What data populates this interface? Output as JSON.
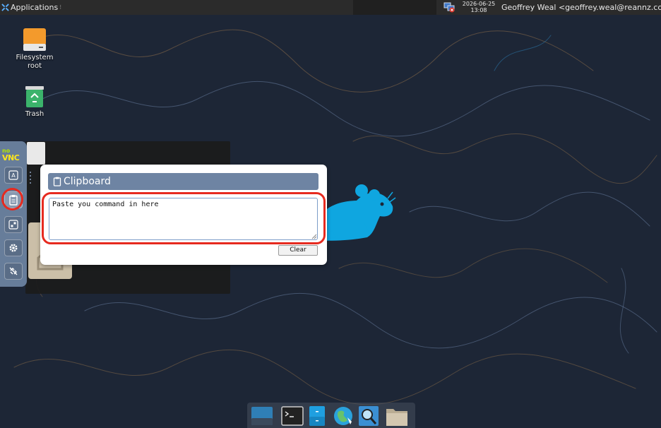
{
  "top_panel": {
    "applications_label": "Applications",
    "date": "2026-06-25",
    "time": "13:08",
    "user": "Geoffrey Weal <geoffrey.weal@reannz.co.nz>"
  },
  "desktop_icons": [
    {
      "name": "filesystem-root",
      "label_line1": "Filesystem",
      "label_line2": "root"
    },
    {
      "name": "trash",
      "label_line1": "Trash"
    }
  ],
  "novnc": {
    "logo_no": "no",
    "logo_vnc": "VNC",
    "buttons": [
      "keyboard",
      "clipboard",
      "fullscreen",
      "settings",
      "disconnect"
    ]
  },
  "clipboard": {
    "title": "Clipboard",
    "text": "Paste you command in here",
    "clear_label": "Clear"
  },
  "dock_items": [
    "show-desktop",
    "terminal",
    "file-manager",
    "web-browser",
    "app-finder",
    "home-folder"
  ],
  "colors": {
    "panel_bg": "#2b2b2b",
    "desktop_bg": "#1d2636",
    "novnc_accent": "#6e84a3",
    "highlight_red": "#e62a1f",
    "mouse_blue": "#0fa6e0"
  }
}
